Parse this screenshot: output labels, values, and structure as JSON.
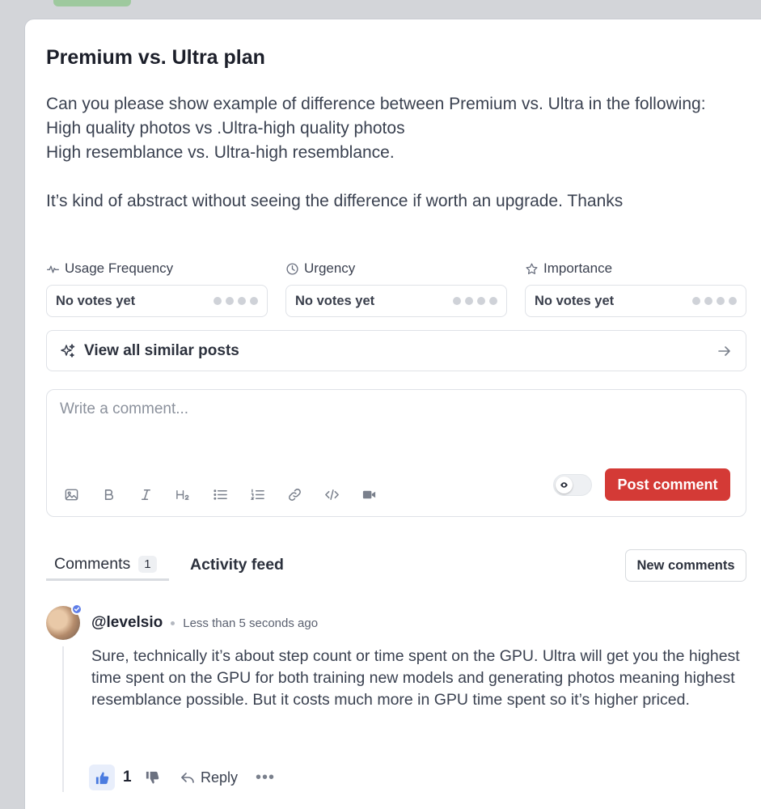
{
  "post": {
    "title": "Premium vs. Ultra plan",
    "body_lines": [
      "Can you please show example of difference between Premium vs. Ultra in the following:",
      "High quality photos vs .Ultra-high quality photos",
      "High resemblance vs. Ultra-high resemblance.",
      "It’s kind of abstract without seeing the difference if worth an upgrade. Thanks"
    ]
  },
  "votes": [
    {
      "label": "Usage Frequency",
      "icon": "activity-icon",
      "value": "No votes yet",
      "filled": 0,
      "total": 4
    },
    {
      "label": "Urgency",
      "icon": "clock-icon",
      "value": "No votes yet",
      "filled": 0,
      "total": 4
    },
    {
      "label": "Importance",
      "icon": "star-icon",
      "value": "No votes yet",
      "filled": 0,
      "total": 4
    }
  ],
  "similar": {
    "label": "View all similar posts",
    "icon": "sparkles-icon",
    "arrow": "arrow-right-icon"
  },
  "composer": {
    "placeholder": "Write a comment...",
    "toolbar": [
      "image-icon",
      "bold-icon",
      "italic-icon",
      "heading-icon",
      "bullet-list-icon",
      "numbered-list-icon",
      "link-icon",
      "code-icon",
      "video-icon"
    ],
    "post_label": "Post comment",
    "accent": "#d43a36"
  },
  "tabs": {
    "comments_label": "Comments",
    "comments_count": "1",
    "activity_label": "Activity feed",
    "new_comments_label": "New comments"
  },
  "comment": {
    "user": "@levelsio",
    "time": "Less than 5 seconds ago",
    "text": "Sure, technically it’s about step count or time spent on the GPU. Ultra will get you the highest time spent on the GPU for both training new models and generating photos meaning highest resemblance possible. But it costs much more in GPU time spent so it’s higher priced.",
    "likes": "1",
    "reply_label": "Reply",
    "more": "•••",
    "like_color": "#4a7be0"
  }
}
